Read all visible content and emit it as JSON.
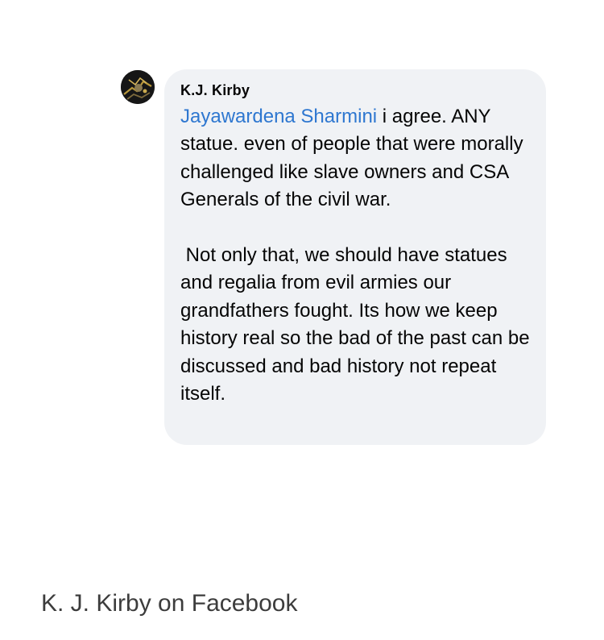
{
  "comment": {
    "author": "K.J. Kirby",
    "mention": "Jayawardena Sharmini",
    "paragraph1_rest": " i agree. ANY statue. even of people that were morally challenged like slave owners and CSA Generals of the civil war.",
    "paragraph2": " Not only that, we should have statues and regalia from evil armies our grandfathers fought. Its how we keep history real so the bad of the past can be discussed and bad history not repeat itself."
  },
  "caption": "K. J. Kirby on Facebook",
  "colors": {
    "bubble_bg": "#f0f2f5",
    "mention": "#2e77d0",
    "text": "#050505",
    "caption": "#3c3c3c"
  },
  "icons": {
    "avatar": "profile-avatar-icon"
  }
}
